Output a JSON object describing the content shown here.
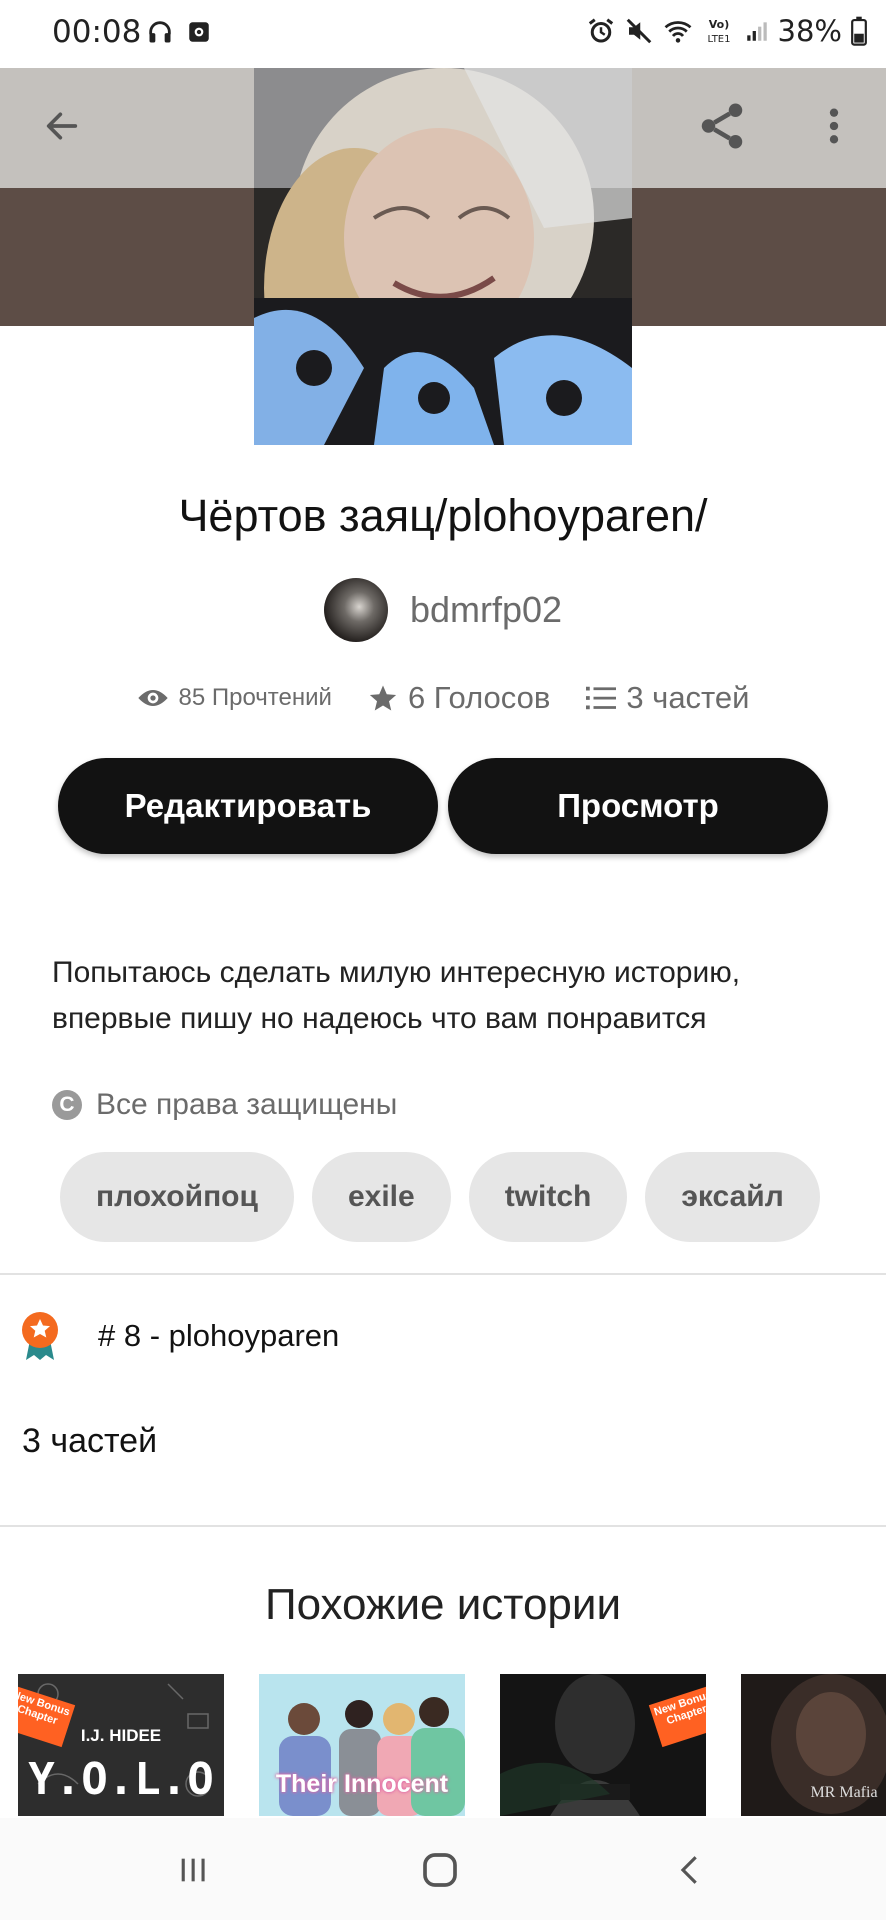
{
  "status_bar": {
    "time": "00:08",
    "battery": "38%",
    "left_icons": [
      "headphones-icon",
      "media-icon"
    ],
    "right_icons": [
      "alarm-icon",
      "mute-icon",
      "wifi-icon",
      "volte-icon",
      "signal-icon",
      "battery-icon"
    ],
    "volte_label": "Vo)\nLTE1"
  },
  "toolbar": {
    "back_icon": "arrow-left-icon",
    "share_icon": "share-icon",
    "more_icon": "more-vertical-icon"
  },
  "story": {
    "title": "Чёртов заяц/plohoyparen/",
    "author": "bdmrfp02",
    "reads": "85 Прочтений",
    "votes": "6 Голосов",
    "parts": "3 частей",
    "description": "Попытаюсь сделать милую интересную историю, впервые пишу но надеюсь что вам понравится",
    "copyright": "Все права защищены",
    "tags": [
      "плохойпоц",
      "exile",
      "twitch",
      "эксайл"
    ]
  },
  "actions": {
    "edit_label": "Редактировать",
    "preview_label": "Просмотр"
  },
  "ranking": {
    "text": "# 8 - plohoyparen"
  },
  "parts_section": {
    "label": "3 частей"
  },
  "similar": {
    "heading": "Похожие истории",
    "books": [
      {
        "author": "I.J. HIDEE",
        "title": "Y.O.L.O",
        "badge": "New Bonus Chapter"
      },
      {
        "title": "Their Innocent"
      },
      {
        "badge": "New Bonus Chapter"
      },
      {
        "title": "MR Mafia"
      }
    ]
  },
  "colors": {
    "primary_button": "#121212",
    "tag_bg": "#e6e6e6",
    "badge_orange": "#ff6122",
    "rank_orange": "#f46a1f",
    "rank_teal": "#2a8a8c"
  }
}
